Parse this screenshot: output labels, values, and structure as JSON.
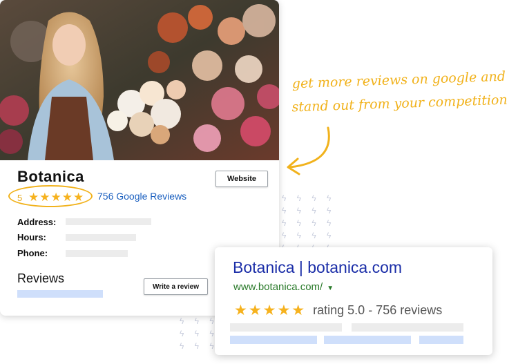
{
  "card": {
    "name": "Botanica",
    "website_label": "Website",
    "rating_value": "5",
    "stars": "★★★★★",
    "reviews_link": "756 Google Reviews",
    "address_label": "Address:",
    "hours_label": "Hours:",
    "phone_label": "Phone:",
    "reviews_heading": "Reviews",
    "write_review_label": "Write a review"
  },
  "callout": {
    "line1": "get more reviews on google and",
    "line2": "stand out from your competition"
  },
  "search_result": {
    "title": "Botanica | botanica.com",
    "url": "www.botanica.com/",
    "caret": "▼",
    "stars": "★★★★★",
    "rating_text": "rating 5.0 - 756 reviews"
  },
  "colors": {
    "accent_yellow": "#f1b21c",
    "link_blue": "#1a5fbf",
    "title_blue": "#1b2ea8",
    "url_green": "#2a7a2a"
  }
}
